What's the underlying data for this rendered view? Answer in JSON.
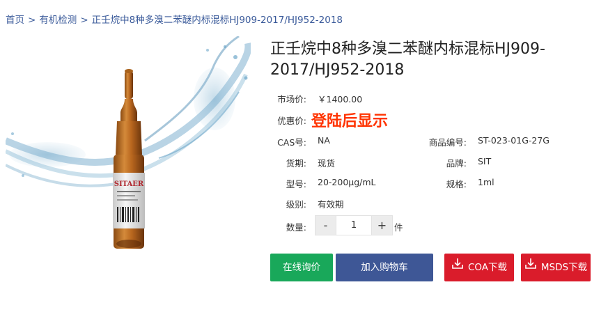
{
  "breadcrumb": {
    "home": "首页",
    "category": "有机检测",
    "current": "正壬烷中8种多溴二苯醚内标混标HJ909-2017/HJ952-2018",
    "separator": ">"
  },
  "product": {
    "title": "正壬烷中8种多溴二苯醚内标混标HJ909-2017/HJ952-2018",
    "image_icon": "ampoule-vial-image",
    "label_text": "SITAER",
    "market_price_label": "市场价:",
    "market_price": "￥1400.00",
    "promo_price_label": "优惠价:",
    "promo_price": "登陆后显示",
    "promo_color": "#ff3300",
    "cas_label": "CAS号:",
    "cas_value": "NA",
    "item_no_label": "商品编号:",
    "item_no_value": "ST-023-01G-27G",
    "stock_label": "货期:",
    "stock_value": "现货",
    "brand_label": "品牌:",
    "brand_value": "SIT",
    "model_label": "型号:",
    "model_value": "20-200μg/mL",
    "spec_label": "规格:",
    "spec_value": "1ml",
    "grade_label": "级别:",
    "grade_value": "有效期"
  },
  "quantity": {
    "label": "数量:",
    "minus": "-",
    "value": "1",
    "plus": "+",
    "unit": "件"
  },
  "actions": {
    "inquiry": "在线询价",
    "cart": "加入购物车",
    "coa": "COA下载",
    "msds": "MSDS下载",
    "download_icon": "download-icon",
    "colors": {
      "inquiry": "#19a85a",
      "cart": "#3e5796",
      "download": "#da1c2b"
    }
  }
}
